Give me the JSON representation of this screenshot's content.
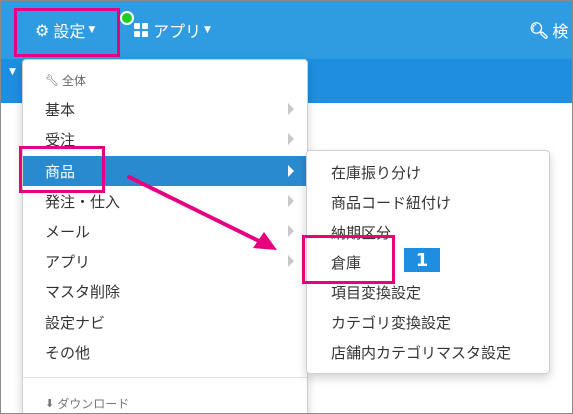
{
  "navbar": {
    "settings_label": "設定",
    "apps_label": "アプリ",
    "search_label": "検"
  },
  "menu": {
    "section_header": "全体",
    "items": [
      {
        "label": "基本"
      },
      {
        "label": "受注"
      },
      {
        "label": "商品"
      },
      {
        "label": "発注・仕入"
      },
      {
        "label": "メール"
      },
      {
        "label": "アプリ"
      },
      {
        "label": "マスタ削除"
      },
      {
        "label": "設定ナビ"
      },
      {
        "label": "その他"
      }
    ],
    "footer_partial": "ダウンロード"
  },
  "submenu": {
    "items": [
      {
        "label": "在庫振り分け"
      },
      {
        "label": "商品コード紐付け"
      },
      {
        "label": "納期区分"
      },
      {
        "label": "倉庫"
      },
      {
        "label": "項目変換設定"
      },
      {
        "label": "カテゴリ変換設定"
      },
      {
        "label": "店舗内カテゴリマスタ設定"
      }
    ]
  },
  "annotation": {
    "step_number": "1",
    "highlight_color": "#e6007e",
    "badge_color": "#1e8fe0"
  },
  "colors": {
    "navbar": "#2f9be0",
    "active_item": "#2a8ad0"
  }
}
